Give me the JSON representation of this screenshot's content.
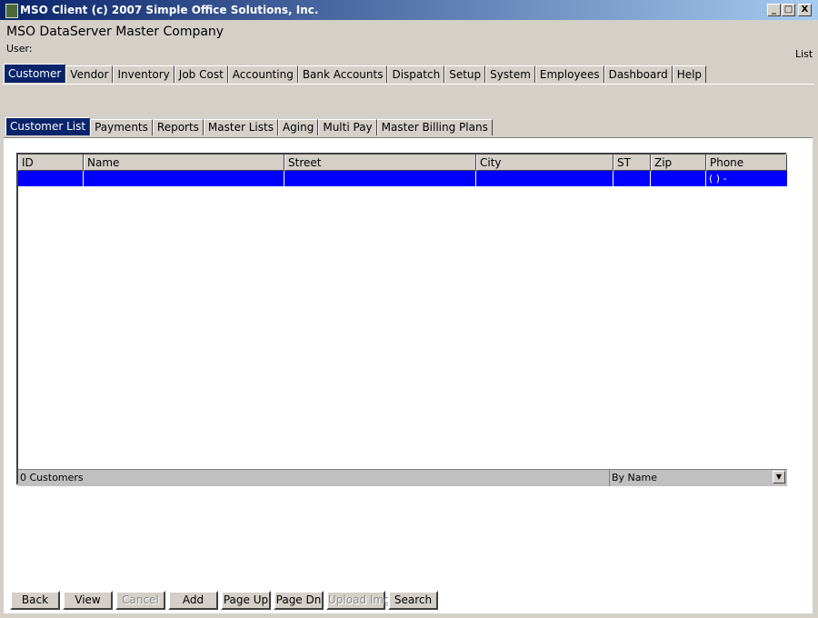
{
  "window": {
    "title": "MSO Client (c) 2007 Simple Office Solutions, Inc.",
    "controls": [
      "_",
      "□",
      "X"
    ]
  },
  "header": {
    "company": "MSO DataServer Master Company",
    "user_label": "User:",
    "list_label": "List"
  },
  "main_tabs": [
    "Customer",
    "Vendor",
    "Inventory",
    "Job Cost",
    "Accounting",
    "Bank Accounts",
    "Dispatch",
    "Setup",
    "System",
    "Employees",
    "Dashboard",
    "Help"
  ],
  "sub_tabs": [
    "Customer List",
    "Payments",
    "Reports",
    "Master Lists",
    "Aging",
    "Multi Pay",
    "Master Billing Plans"
  ],
  "grid": {
    "columns": [
      "ID",
      "Name",
      "Street",
      "City",
      "ST",
      "Zip",
      "Phone"
    ],
    "selected_row": [
      "",
      "",
      "",
      "",
      "",
      "",
      "(   )      -"
    ],
    "count": "0 Customers",
    "sort": "By Name"
  },
  "buttons": {
    "back": "Back",
    "view": "View",
    "cancel": "Cancel",
    "add": "Add",
    "page_up": "Page Up",
    "page_dn": "Page Dn",
    "upload_img": "Upload Img",
    "search": "Search"
  },
  "colors": {
    "title_gradient_start": "#0a246a",
    "selection": "#0000ff",
    "face": "#d4d0c8"
  }
}
